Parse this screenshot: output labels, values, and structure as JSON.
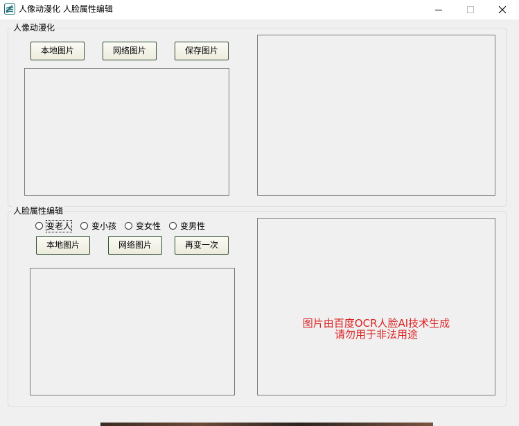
{
  "window": {
    "title": "人像动漫化 人脸属性编辑"
  },
  "anime_group": {
    "title": "人像动漫化",
    "local_image_button": "本地图片",
    "network_image_button": "网络图片",
    "save_image_button": "保存图片"
  },
  "face_edit_group": {
    "title": "人脸属性编辑",
    "options": [
      {
        "label": "变老人",
        "selected": false
      },
      {
        "label": "变小孩",
        "selected": false
      },
      {
        "label": "变女性",
        "selected": false
      },
      {
        "label": "变男性",
        "selected": false
      }
    ],
    "local_image_button": "本地图片",
    "network_image_button": "网络图片",
    "transform_again_button": "再变一次",
    "notice_line1": "图片由百度OCR人脸AI技术生成",
    "notice_line2": "请勿用于非法用途"
  },
  "colors": {
    "notice_text": "#dd2222",
    "button_border": "#2f4f2f",
    "window_background": "#f0f0f0"
  }
}
